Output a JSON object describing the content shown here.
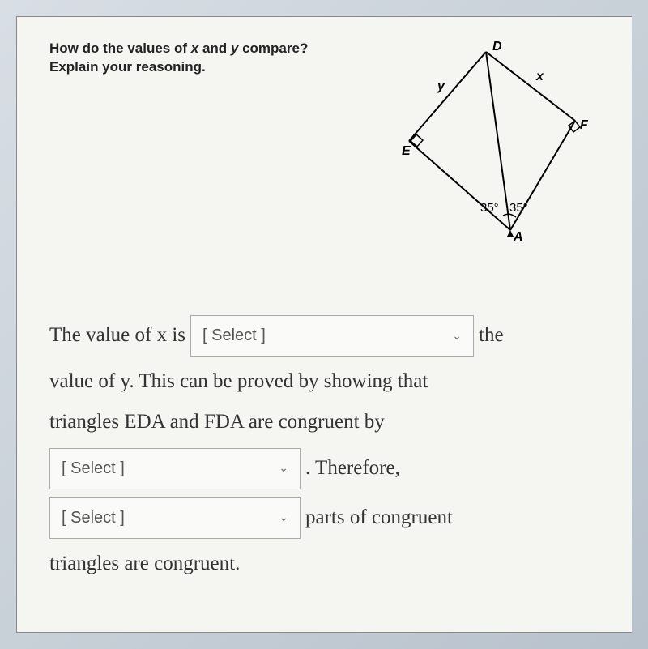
{
  "question": {
    "line1_prefix": "How do the values of ",
    "var_x": "x",
    "line1_mid": " and ",
    "var_y": "y",
    "line1_suffix": " compare?",
    "line2": "Explain your reasoning."
  },
  "diagram": {
    "labels": {
      "D": "D",
      "E": "E",
      "F": "F",
      "A": "A",
      "x": "x",
      "y": "y",
      "angle_left": "35°",
      "angle_right": "35°"
    }
  },
  "answer": {
    "seg1": "The value of x is",
    "select1_placeholder": "[ Select ]",
    "seg2": "the",
    "seg3": "value of y.  This can be proved by showing that",
    "seg4": "triangles EDA and FDA are congruent by",
    "select2_placeholder": "[ Select ]",
    "seg5": ".  Therefore,",
    "select3_placeholder": "[ Select ]",
    "seg6": "parts of congruent",
    "seg7": "triangles are congruent."
  }
}
